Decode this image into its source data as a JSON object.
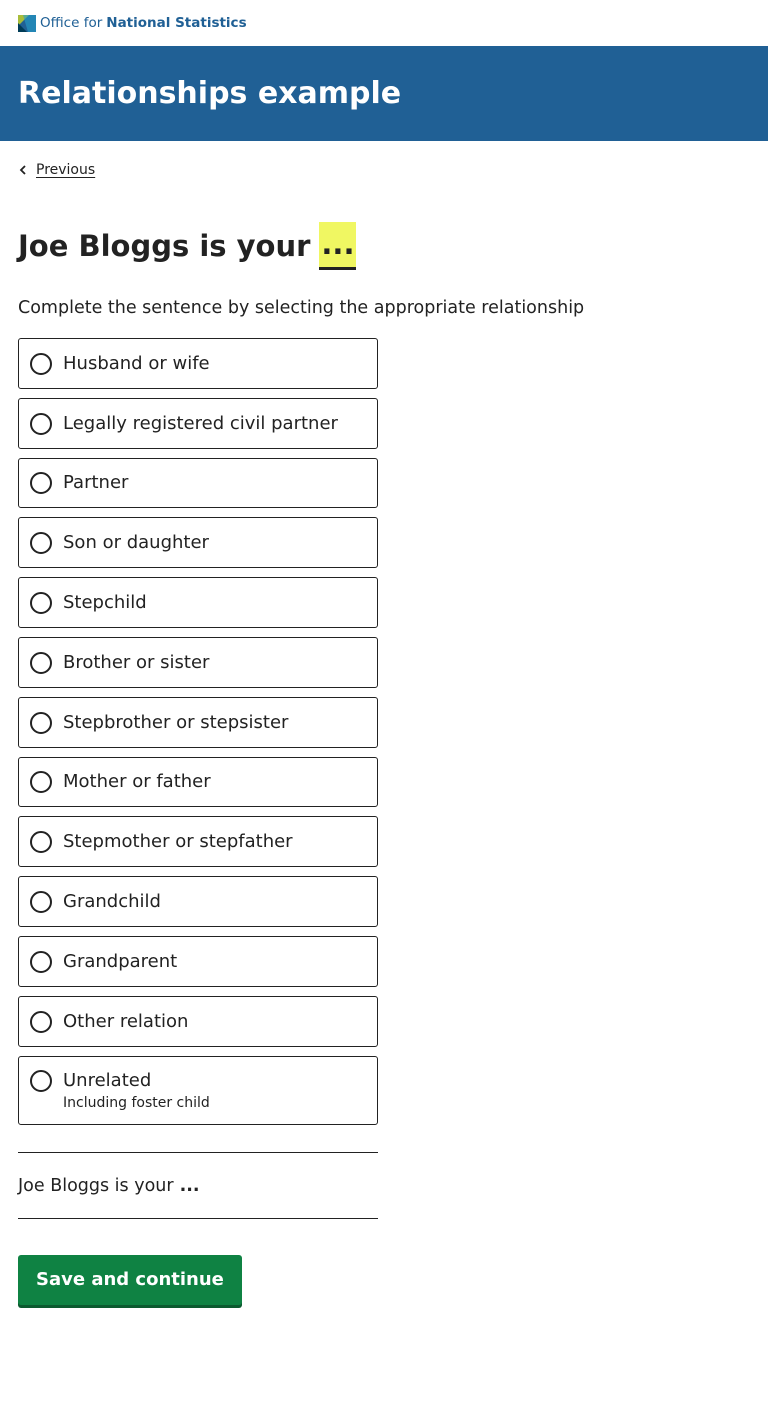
{
  "header": {
    "logo_text_1": "Office for ",
    "logo_text_2": "National Statistics",
    "brand_color": "#206095"
  },
  "banner": {
    "title": "Relationships example"
  },
  "nav": {
    "previous_label": "Previous"
  },
  "question": {
    "title": "Joe Bloggs is your",
    "highlight": "...",
    "description": "Complete the sentence by selecting the appropriate relationship"
  },
  "options": [
    {
      "label": "Husband or wife"
    },
    {
      "label": "Legally registered civil partner"
    },
    {
      "label": "Partner"
    },
    {
      "label": "Son or daughter"
    },
    {
      "label": "Stepchild"
    },
    {
      "label": "Brother or sister"
    },
    {
      "label": "Stepbrother or stepsister"
    },
    {
      "label": "Mother or father"
    },
    {
      "label": "Stepmother or stepfather"
    },
    {
      "label": "Grandchild"
    },
    {
      "label": "Grandparent"
    },
    {
      "label": "Other relation"
    },
    {
      "label": "Unrelated",
      "description": "Including foster child"
    }
  ],
  "answer": {
    "prefix": "Joe Bloggs is your",
    "value": "..."
  },
  "actions": {
    "submit_label": "Save and continue",
    "submit_color": "#0f8243"
  }
}
